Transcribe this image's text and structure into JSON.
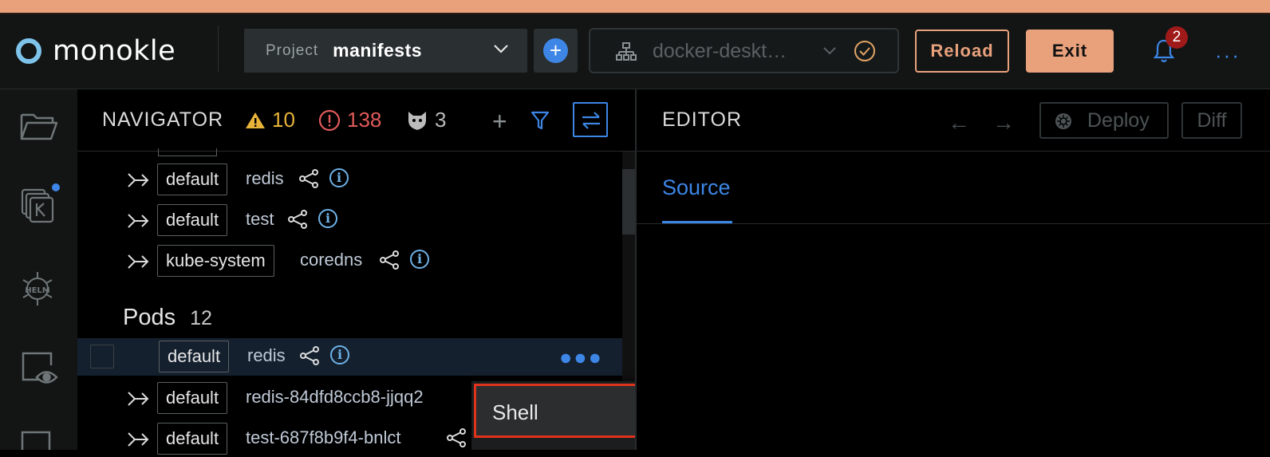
{
  "app": {
    "name": "monokle"
  },
  "header": {
    "project_label": "Project",
    "project_value": "manifests",
    "cluster_name": "docker-deskt…",
    "reload_label": "Reload",
    "exit_label": "Exit",
    "notification_count": "2",
    "more_label": "···"
  },
  "navigator": {
    "title": "NAVIGATOR",
    "warnings": "10",
    "errors": "138",
    "policies": "3",
    "plus": "+",
    "rows_top": [
      {
        "namespace": "default",
        "name": "redis"
      },
      {
        "namespace": "default",
        "name": "test"
      },
      {
        "namespace": "kube-system",
        "name": "coredns"
      }
    ],
    "section": {
      "title": "Pods",
      "count": "12"
    },
    "selected": {
      "namespace": "default",
      "name": "redis",
      "more": "●●●"
    },
    "rows_bottom": [
      {
        "namespace": "default",
        "name": "redis-84dfd8ccb8-jjqq2"
      },
      {
        "namespace": "default",
        "name": "test-687f8b9f4-bnlct"
      }
    ],
    "info_glyph": "i"
  },
  "context_menu": {
    "items": [
      "Shell"
    ]
  },
  "editor": {
    "title": "EDITOR",
    "back": "←",
    "forward": "→",
    "deploy_label": "Deploy",
    "diff_label": "Diff",
    "tabs": [
      "Source"
    ]
  },
  "colors": {
    "accent": "#3d86e6",
    "brand": "#e9a17c",
    "warning": "#e8b339",
    "error": "#e05a5a",
    "highlight": "#e0331c"
  }
}
